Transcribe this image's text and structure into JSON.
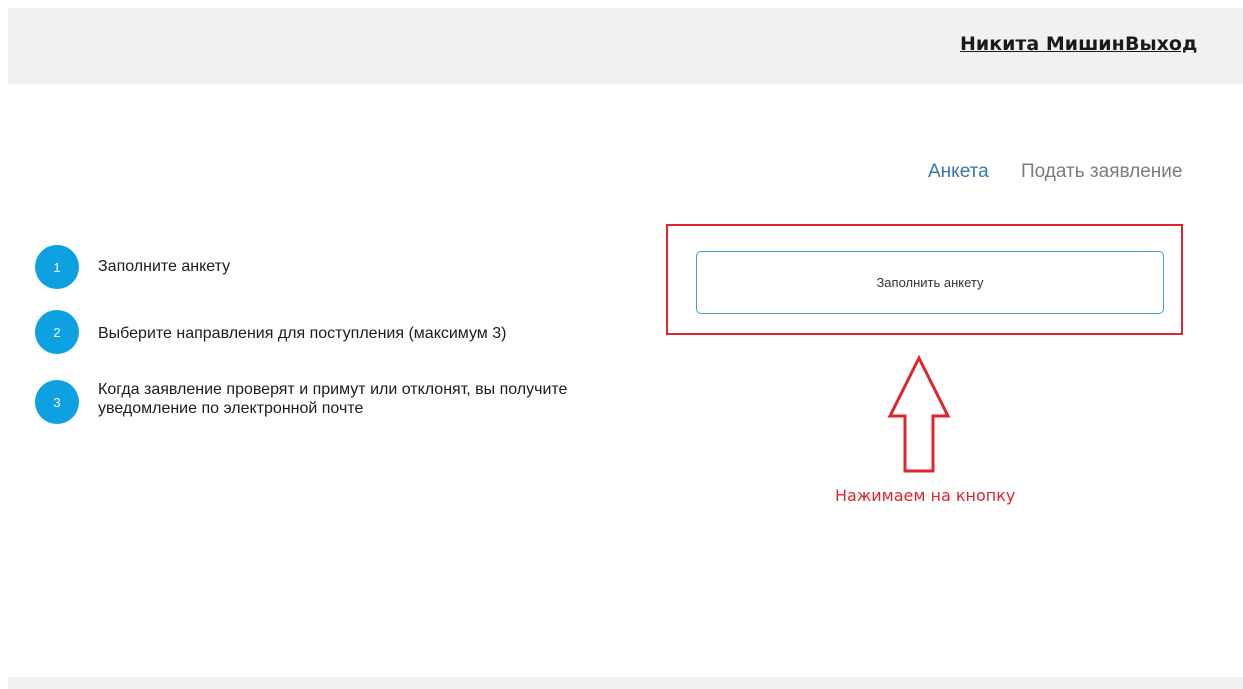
{
  "header": {
    "user_name": "Никита Мишин",
    "logout_label": "Выход"
  },
  "tabs": [
    {
      "label": "Анкета",
      "active": true
    },
    {
      "label": "Подать заявление",
      "active": false
    }
  ],
  "steps": [
    {
      "number": "1",
      "text": "Заполните анкету"
    },
    {
      "number": "2",
      "text": "Выберите направления для поступления (максимум 3)"
    },
    {
      "number": "3",
      "text_line1": "Когда заявление проверят и примут или отклонят, вы получите",
      "text_line2": "уведомление по электронной почте"
    }
  ],
  "main": {
    "fill_button_label": "Заполнить анкету"
  },
  "annotation": {
    "text": "Нажимаем на кнопку",
    "color": "#e0242e"
  },
  "colors": {
    "accent": "#0ea1e2",
    "active_tab": "#3576b3",
    "button_border": "#3aa0d3",
    "header_bg": "#f1f1f1"
  }
}
